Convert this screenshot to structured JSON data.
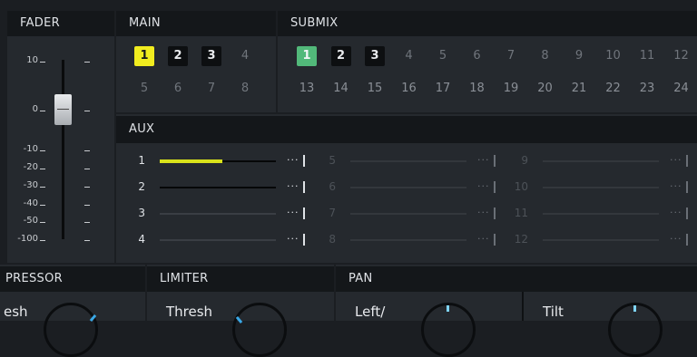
{
  "fader": {
    "title": "FADER",
    "scale": [
      "10",
      "0",
      "-10",
      "-20",
      "-30",
      "-40",
      "-50",
      "-100"
    ]
  },
  "main": {
    "title": "MAIN",
    "buses": [
      "1",
      "2",
      "3",
      "4",
      "5",
      "6",
      "7",
      "8"
    ],
    "active_bus": "1"
  },
  "submix": {
    "title": "SUBMIX",
    "buses": [
      "1",
      "2",
      "3",
      "4",
      "5",
      "6",
      "7",
      "8",
      "9",
      "10",
      "11",
      "12",
      "13",
      "14",
      "15",
      "16",
      "17",
      "18",
      "19",
      "20",
      "21",
      "22",
      "23",
      "24"
    ],
    "active_bus": "1"
  },
  "aux": {
    "title": "AUX",
    "sends": [
      {
        "label": "1",
        "level": 0.54,
        "enabled": true
      },
      {
        "label": "2",
        "level": 1.0,
        "enabled": true
      },
      {
        "label": "3",
        "level": 0,
        "enabled": true
      },
      {
        "label": "4",
        "level": 0,
        "enabled": true
      },
      {
        "label": "5",
        "level": 0,
        "enabled": false
      },
      {
        "label": "6",
        "level": 0,
        "enabled": false
      },
      {
        "label": "7",
        "level": 0,
        "enabled": false
      },
      {
        "label": "8",
        "level": 0,
        "enabled": false
      },
      {
        "label": "9",
        "level": 0,
        "enabled": false
      },
      {
        "label": "10",
        "level": 0,
        "enabled": false
      },
      {
        "label": "11",
        "level": 0,
        "enabled": false
      },
      {
        "label": "12",
        "level": 0,
        "enabled": false
      }
    ]
  },
  "compressor": {
    "title": "PRESSOR",
    "param": "esh"
  },
  "limiter": {
    "title": "LIMITER",
    "param": "Thresh"
  },
  "pan": {
    "title": "PAN",
    "param_left": "Left/",
    "param_right": "Tilt"
  },
  "colors": {
    "main_active": "#f1ec1f",
    "submix_active": "#52b97a",
    "aux_level": "#d9e21a",
    "knob_accent": "#3aa8e6"
  }
}
